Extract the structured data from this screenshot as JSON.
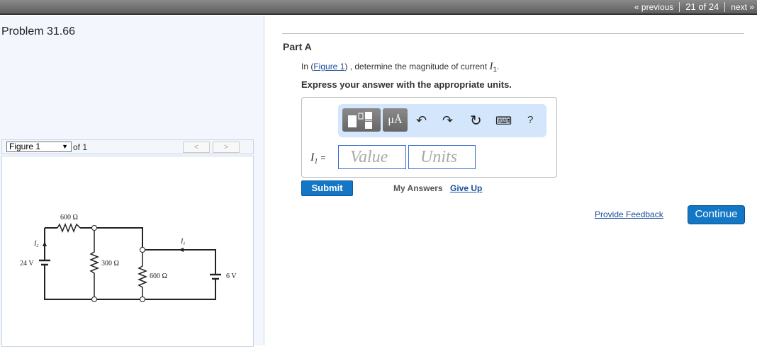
{
  "nav": {
    "previous": "« previous",
    "counter": "21 of 24",
    "next": "next »"
  },
  "problem": {
    "title": "Problem 31.66"
  },
  "figure": {
    "selected": "Figure 1",
    "of": "of 1",
    "prev": "<",
    "next": ">",
    "labels": {
      "r1": "600 Ω",
      "r2": "300 Ω",
      "r3": "600 Ω",
      "v1": "24 V",
      "v2": "6 V",
      "i1": "I",
      "i1_sub": "1",
      "i2": "I",
      "i2_sub": "2"
    }
  },
  "part": {
    "title": "Part A",
    "q_pre": "In (",
    "q_link": "Figure 1",
    "q_post": ") , determine the magnitude of current ",
    "q_var": "I",
    "q_sub": "1",
    "q_end": ".",
    "instruction": "Express your answer with the appropriate units."
  },
  "toolbar": {
    "units_btn": "μÅ",
    "undo": "↶",
    "redo": "↷",
    "reset": "↻",
    "keyboard": "⌨",
    "help": "?"
  },
  "answer": {
    "label": "I",
    "label_sub": "1",
    "eq": "=",
    "value_placeholder": "Value",
    "units_placeholder": "Units"
  },
  "actions": {
    "submit": "Submit",
    "my_answers": "My Answers",
    "give_up": "Give Up",
    "feedback": "Provide Feedback",
    "continue": "Continue"
  }
}
